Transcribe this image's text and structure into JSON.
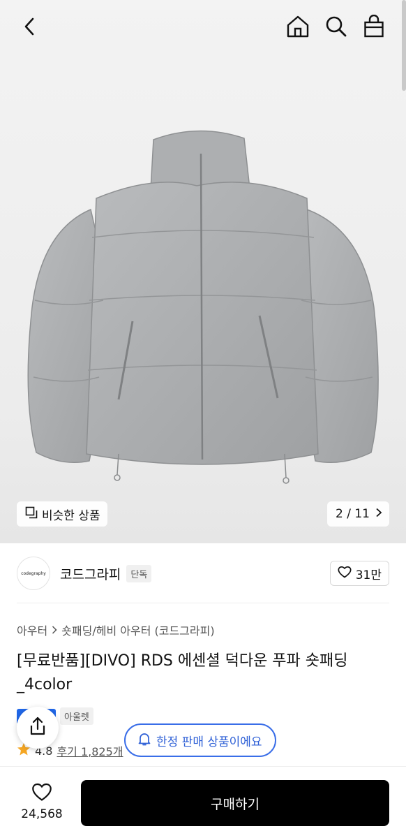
{
  "header": {
    "back_icon": "chevron-left-icon",
    "home_icon": "home-icon",
    "search_icon": "search-icon",
    "bag_icon": "shopping-bag-icon"
  },
  "gallery": {
    "similar_label": "비슷한 상품",
    "counter": "2 / 11",
    "jacket_color": "#a9abad"
  },
  "brand": {
    "logo_text": "codegraphy",
    "name": "코드그라피",
    "badge": "단독",
    "likes": "31만"
  },
  "breadcrumb": {
    "level1": "아우터",
    "level2": "숏패딩/헤비 아우터 (코드그라피)"
  },
  "product": {
    "title": "[무료반품][DIVO] RDS 에센셜 덕다운 푸파 숏패딩_4color",
    "outlet_badge": "아울렛",
    "rating": "4.8",
    "reviews": "후기 1,825개"
  },
  "toast": {
    "limited_text": "한정 판매 상품이에요"
  },
  "bottom": {
    "wish_count": "24,568",
    "buy_label": "구매하기"
  },
  "colors": {
    "accent_blue": "#2d5fd6",
    "buy_button": "#000000",
    "star": "#f5a623"
  }
}
